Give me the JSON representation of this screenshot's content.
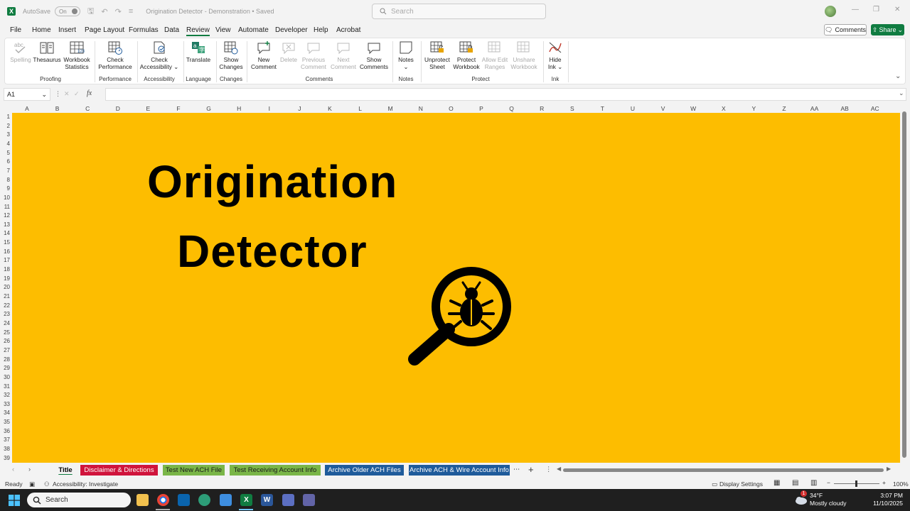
{
  "titlebar": {
    "autosave_label": "AutoSave",
    "autosave_state": "On",
    "document_title": "Origination Detector - Demonstration • Saved",
    "search_placeholder": "Search"
  },
  "menu": {
    "items": [
      "File",
      "Home",
      "Insert",
      "Page Layout",
      "Formulas",
      "Data",
      "Review",
      "View",
      "Automate",
      "Developer",
      "Help",
      "Acrobat"
    ],
    "active": "Review",
    "comments_button": "Comments",
    "share_button": "Share"
  },
  "ribbon": {
    "buttons": {
      "spelling": "Spelling",
      "thesaurus": "Thesaurus",
      "workbook_statistics_1": "Workbook",
      "workbook_statistics_2": "Statistics",
      "check_performance_1": "Check",
      "check_performance_2": "Performance",
      "check_accessibility_1": "Check",
      "check_accessibility_2": "Accessibility",
      "translate": "Translate",
      "show_changes_1": "Show",
      "show_changes_2": "Changes",
      "new_comment_1": "New",
      "new_comment_2": "Comment",
      "delete": "Delete",
      "previous_comment_1": "Previous",
      "previous_comment_2": "Comment",
      "next_comment_1": "Next",
      "next_comment_2": "Comment",
      "show_comments_1": "Show",
      "show_comments_2": "Comments",
      "notes": "Notes",
      "unprotect_sheet_1": "Unprotect",
      "unprotect_sheet_2": "Sheet",
      "protect_workbook_1": "Protect",
      "protect_workbook_2": "Workbook",
      "allow_edit_ranges_1": "Allow Edit",
      "allow_edit_ranges_2": "Ranges",
      "unshare_workbook_1": "Unshare",
      "unshare_workbook_2": "Workbook",
      "hide_ink_1": "Hide",
      "hide_ink_2": "Ink"
    },
    "groups": {
      "proofing": "Proofing",
      "performance": "Performance",
      "accessibility": "Accessibility",
      "language": "Language",
      "changes": "Changes",
      "comments": "Comments",
      "notes": "Notes",
      "protect": "Protect",
      "ink": "Ink"
    }
  },
  "formula_bar": {
    "name_box": "A1",
    "fx": "fx",
    "value": ""
  },
  "sheet": {
    "columns": [
      "A",
      "B",
      "C",
      "D",
      "E",
      "F",
      "G",
      "H",
      "I",
      "J",
      "K",
      "L",
      "M",
      "N",
      "O",
      "P",
      "Q",
      "R",
      "S",
      "T",
      "U",
      "V",
      "W",
      "X",
      "Y",
      "Z",
      "AA",
      "AB",
      "AC"
    ],
    "rows": [
      "1",
      "2",
      "3",
      "4",
      "5",
      "6",
      "7",
      "8",
      "9",
      "10",
      "11",
      "12",
      "13",
      "14",
      "15",
      "16",
      "17",
      "18",
      "19",
      "20",
      "21",
      "22",
      "23",
      "24",
      "25",
      "26",
      "27",
      "28",
      "29",
      "30",
      "31",
      "32",
      "33",
      "34",
      "35",
      "36",
      "37",
      "38",
      "39"
    ],
    "background_color": "#fdbd00",
    "title_line1": "Origination",
    "title_line2": "Detector",
    "graphic_icon": "magnifier-bug-icon"
  },
  "tabs": [
    {
      "label": "Title",
      "color": "#ffffff",
      "text_color": "#000000",
      "active": true
    },
    {
      "label": "Disclaimer & Directions",
      "color": "#d0143c",
      "text_color": "#ffffff"
    },
    {
      "label": "Test New ACH File",
      "color": "#7ab648",
      "text_color": "#1a1a1a"
    },
    {
      "label": "Test Receiving Account Info",
      "color": "#7ab648",
      "text_color": "#1a1a1a"
    },
    {
      "label": "Archive Older ACH Files",
      "color": "#1f5b9b",
      "text_color": "#ffffff"
    },
    {
      "label": "Archive ACH & Wire Account Info",
      "color": "#1f5b9b",
      "text_color": "#ffffff"
    }
  ],
  "status": {
    "ready": "Ready",
    "accessibility": "Accessibility: Investigate",
    "display_settings": "Display Settings",
    "zoom": "100%"
  },
  "taskbar": {
    "search": "Search",
    "weather_temp": "34°F",
    "weather_desc": "Mostly cloudy",
    "weather_badge": "1",
    "time": "3:07 PM",
    "date": "11/10/2025"
  }
}
